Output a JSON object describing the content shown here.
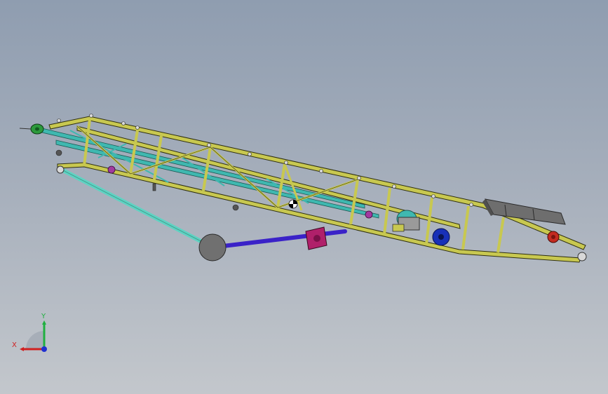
{
  "viewport": {
    "background_top": "#8f9db0",
    "background_bottom": "#c3c7cc"
  },
  "model": {
    "name_icon": "belt-conveyor-model",
    "colors": {
      "truss": "#c8c850",
      "truss_outline": "#2e2e10",
      "inner_frame": "#3fb8b0",
      "support_leg": "#5fd3c3",
      "hydraulic_rod": "#3a22c8",
      "cylinder_body": "#b0206a",
      "pivot_ball": "#707070",
      "head_pulley": "#2c9a3c",
      "tail_pulley": "#c42a20",
      "motor": "#1830b8",
      "idler": "#a23aa0",
      "wheel": "#d8d8d8"
    }
  },
  "triad": {
    "x_label": "X",
    "y_label": "Y",
    "x_color": "#d02020",
    "y_color": "#20b040",
    "z_color": "#2030d0"
  }
}
